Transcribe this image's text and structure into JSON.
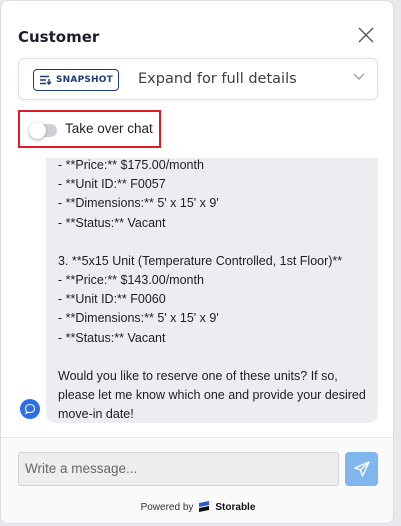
{
  "header": {
    "title": "Customer",
    "close_icon": "close-icon"
  },
  "snapshot": {
    "badge_label": "SNAPSHOT",
    "expand_label": "Expand for full details",
    "badge_color": "#1f3a77"
  },
  "takeover": {
    "label": "Take over chat",
    "enabled": false,
    "highlight_color": "#dc1c2b"
  },
  "chat": {
    "partial_top_line": "- **Price:** $175.00/month",
    "lines_group1": [
      "- **Unit ID:** F0057",
      "- **Dimensions:** 5' x 15' x 9'",
      "- **Status:** Vacant"
    ],
    "lines_group2": [
      "3. **5x15 Unit (Temperature Controlled, 1st Floor)**",
      "- **Price:** $143.00/month",
      "- **Unit ID:** F0060",
      "- **Dimensions:** 5' x 15' x 9'",
      "- **Status:** Vacant"
    ],
    "closing": "Would you like to reserve one of these units? If so, please let me know which one and provide your desired move-in date!"
  },
  "composer": {
    "placeholder": "Write a message...",
    "send_color": "#7fb6ee"
  },
  "footer": {
    "powered_by": "Powered by",
    "brand": "Storable"
  }
}
